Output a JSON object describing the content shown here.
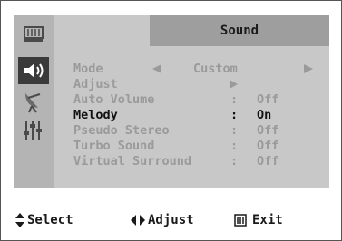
{
  "menu": {
    "title": "Sound",
    "tabs": [
      {
        "icon": "picture-icon",
        "active": false
      },
      {
        "icon": "speaker-icon",
        "active": true
      },
      {
        "icon": "antenna-icon",
        "active": false
      },
      {
        "icon": "setup-sliders-icon",
        "active": false
      }
    ],
    "items": [
      {
        "label": "Mode",
        "value": "Custom",
        "selected": false
      },
      {
        "label": "Adjust",
        "value": "",
        "selected": false
      },
      {
        "label": "Auto Volume",
        "value": "Off",
        "selected": false
      },
      {
        "label": "Melody",
        "value": "On",
        "selected": true
      },
      {
        "label": "Pseudo Stereo",
        "value": "Off",
        "selected": false
      },
      {
        "label": "Turbo Sound",
        "value": "Off",
        "selected": false
      },
      {
        "label": "Virtual Surround",
        "value": "Off",
        "selected": false
      }
    ],
    "colon": ":"
  },
  "footer": {
    "select_label": "Select",
    "adjust_label": "Adjust",
    "exit_label": "Exit"
  },
  "colors": {
    "panel": "#c8c8c8",
    "tab_column": "#b4b4b4",
    "title_bar": "#9e9e9e",
    "active_tab": "#3a3a3a",
    "dim_text": "#9a9a9a",
    "selected_text": "#111111"
  }
}
